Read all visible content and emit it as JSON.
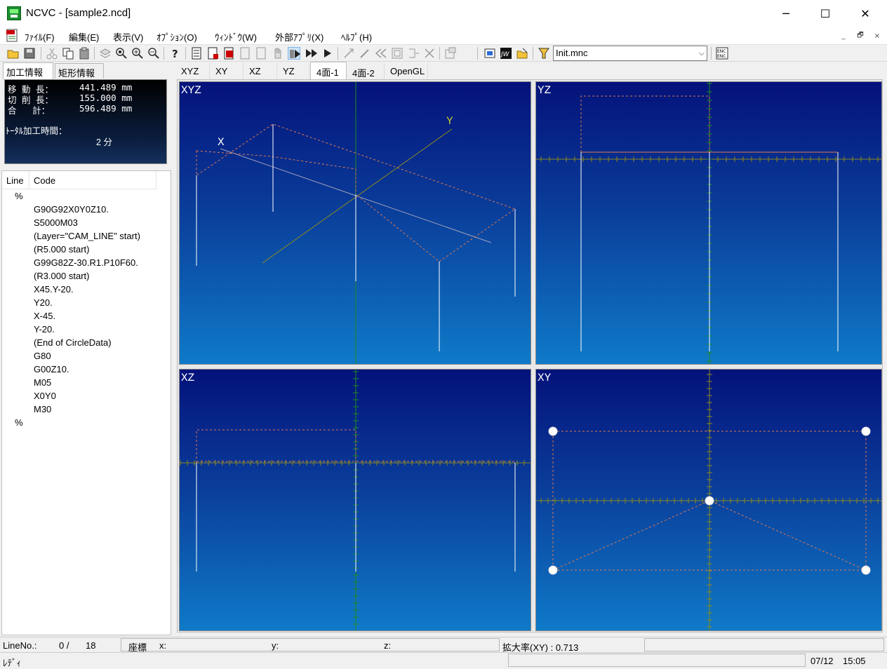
{
  "window": {
    "title": "NCVC - [sample2.ncd]",
    "minimize": "─",
    "maximize": "☐",
    "close": "✕"
  },
  "menu": {
    "items": [
      "ﾌｧｲﾙ(F)",
      "編集(E)",
      "表示(V)",
      "ｵﾌﾟｼｮﾝ(O)",
      "ｳｨﾝﾄﾞｳ(W)",
      "外部ｱﾌﾟﾘ(X)",
      "ﾍﾙﾌﾟ(H)"
    ],
    "mdi_min": "_",
    "mdi_restore": "🗗",
    "mdi_close": "×"
  },
  "toolbar": {
    "combo_value": "Init.mnc",
    "combo_arrow": "⌵"
  },
  "left": {
    "tabs": [
      "加工情報",
      "矩形情報"
    ],
    "info": {
      "move_label": "移 動 長：",
      "move_value": "441.489 mm",
      "cut_label": "切 削 長：",
      "cut_value": "155.000 mm",
      "total_label": "合   計：",
      "total_value": "596.489 mm",
      "time_label": "ﾄｰﾀﾙ加工時間：",
      "time_value": "2 分"
    },
    "code_headers": [
      "Line",
      "Code"
    ],
    "code_lines": [
      {
        "pct": "%",
        "code": ""
      },
      {
        "pct": "",
        "code": "G90G92X0Y0Z10."
      },
      {
        "pct": "",
        "code": "S5000M03"
      },
      {
        "pct": "",
        "code": "(Layer=\"CAM_LINE\" start)"
      },
      {
        "pct": "",
        "code": "(R5.000 start)"
      },
      {
        "pct": "",
        "code": "G99G82Z-30.R1.P10F60."
      },
      {
        "pct": "",
        "code": "(R3.000 start)"
      },
      {
        "pct": "",
        "code": "X45.Y-20."
      },
      {
        "pct": "",
        "code": "Y20."
      },
      {
        "pct": "",
        "code": "X-45."
      },
      {
        "pct": "",
        "code": "Y-20."
      },
      {
        "pct": "",
        "code": "(End of CircleData)"
      },
      {
        "pct": "",
        "code": "G80"
      },
      {
        "pct": "",
        "code": "G00Z10."
      },
      {
        "pct": "",
        "code": "M05"
      },
      {
        "pct": "",
        "code": "X0Y0"
      },
      {
        "pct": "",
        "code": "M30"
      },
      {
        "pct": "%",
        "code": ""
      }
    ]
  },
  "view_tabs": [
    "XYZ",
    "XY",
    "XZ",
    "YZ",
    "4面-1",
    "4面-2",
    "OpenGL"
  ],
  "active_view_tab": "4面-1",
  "panels": {
    "xyz": {
      "label": "XYZ",
      "axis_x": "X",
      "axis_y": "Y"
    },
    "yz": {
      "label": "YZ"
    },
    "xz": {
      "label": "XZ"
    },
    "xy": {
      "label": "XY"
    }
  },
  "status": {
    "lineno_label": "LineNo.:",
    "lineno_value": "0 /",
    "lineno_total": "18",
    "coord_label": "座標",
    "x_label": "x:",
    "y_label": "y:",
    "z_label": "z:",
    "zoom_label": "拡大率(XY) : 0.713",
    "ready": "ﾚﾃﾞｨ",
    "date": "07/12",
    "time": "15:05"
  }
}
